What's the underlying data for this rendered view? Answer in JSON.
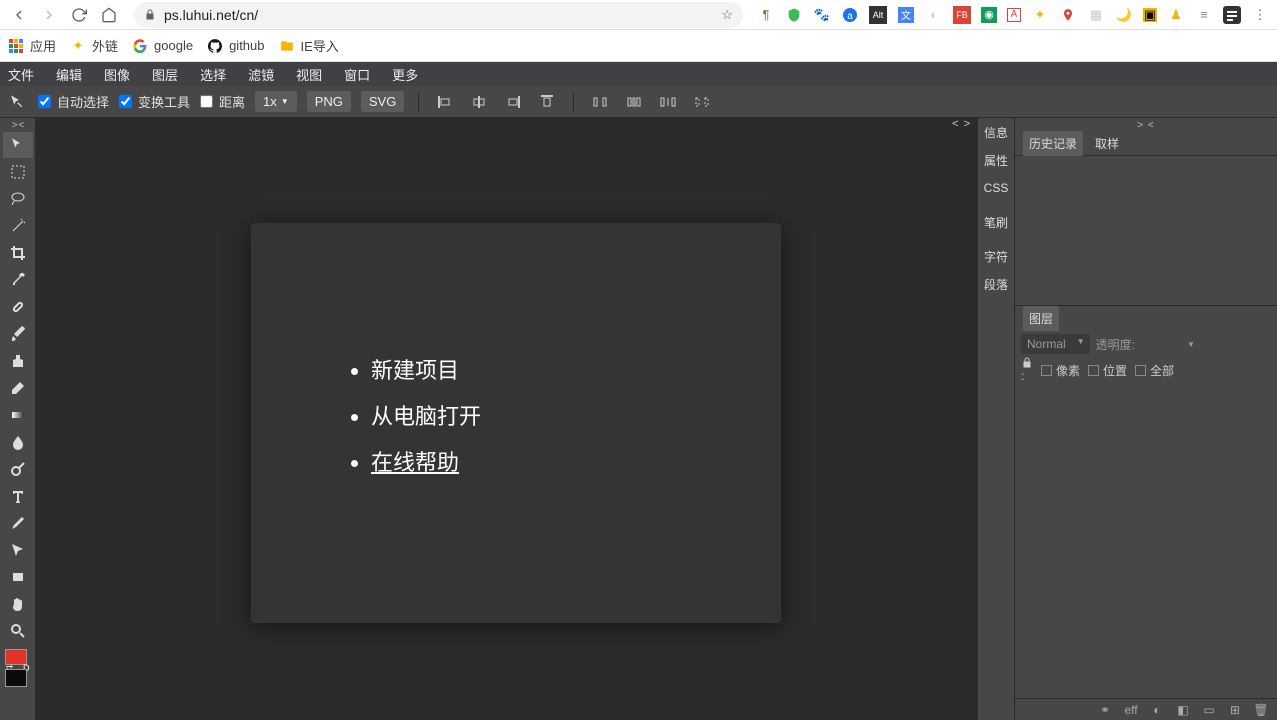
{
  "browser": {
    "url": "ps.luhui.net/cn/"
  },
  "bookmarks": {
    "apps": "应用",
    "external": "外链",
    "google": "google",
    "github": "github",
    "ie_import": "IE导入"
  },
  "menu": {
    "file": "文件",
    "edit": "编辑",
    "image": "图像",
    "layer": "图层",
    "select": "选择",
    "filter": "滤镜",
    "view": "视图",
    "window": "窗口",
    "more": "更多"
  },
  "options": {
    "auto_select": "自动选择",
    "transform": "变换工具",
    "distance": "距离",
    "zoom": "1x",
    "png": "PNG",
    "svg": "SVG"
  },
  "welcome": {
    "new_project": "新建项目",
    "open_local": "从电脑打开",
    "help_online": "在线帮助"
  },
  "right_tabs": {
    "info": "信息",
    "props": "属性",
    "css": "CSS",
    "brush": "笔刷",
    "char": "字符",
    "para": "段落"
  },
  "panels": {
    "history": "历史记录",
    "swatches": "取样",
    "layers": "图层",
    "blend_normal": "Normal",
    "opacity_label": "透明度:",
    "lock_pixel": "像素",
    "lock_position": "位置",
    "lock_all": "全部",
    "eff": "eff"
  },
  "collapse": {
    "left": "> <",
    "right_top": "> <",
    "canvas": "< >"
  }
}
